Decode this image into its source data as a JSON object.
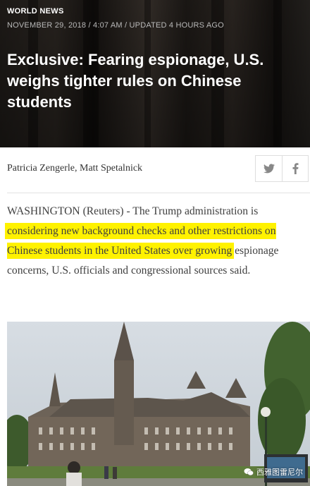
{
  "article": {
    "kicker": "WORLD NEWS",
    "dateline": "NOVEMBER 29, 2018 / 4:07 AM / UPDATED 4 HOURS AGO",
    "headline": "Exclusive: Fearing espionage, U.S. weighs tighter rules on Chinese students",
    "authors": "Patricia Zengerle, Matt Spetalnick",
    "body": {
      "lead": "WASHINGTON (Reuters) - The Trump administration is ",
      "highlight": "considering new background checks and other restrictions on Chinese students in the United States over growing",
      "tail": " espionage concerns, U.S. officials and congressional sources said."
    }
  },
  "share": {
    "twitter_icon": "twitter-icon",
    "facebook_icon": "facebook-icon"
  },
  "colors": {
    "highlight": "#fff200",
    "text": "#404040",
    "kicker": "#ffffff",
    "dateline": "#b9b9b9"
  },
  "photo": {
    "subject": "university-building-icon"
  },
  "watermark": {
    "label": "西雅图雷尼尔",
    "icon": "wechat-icon"
  }
}
